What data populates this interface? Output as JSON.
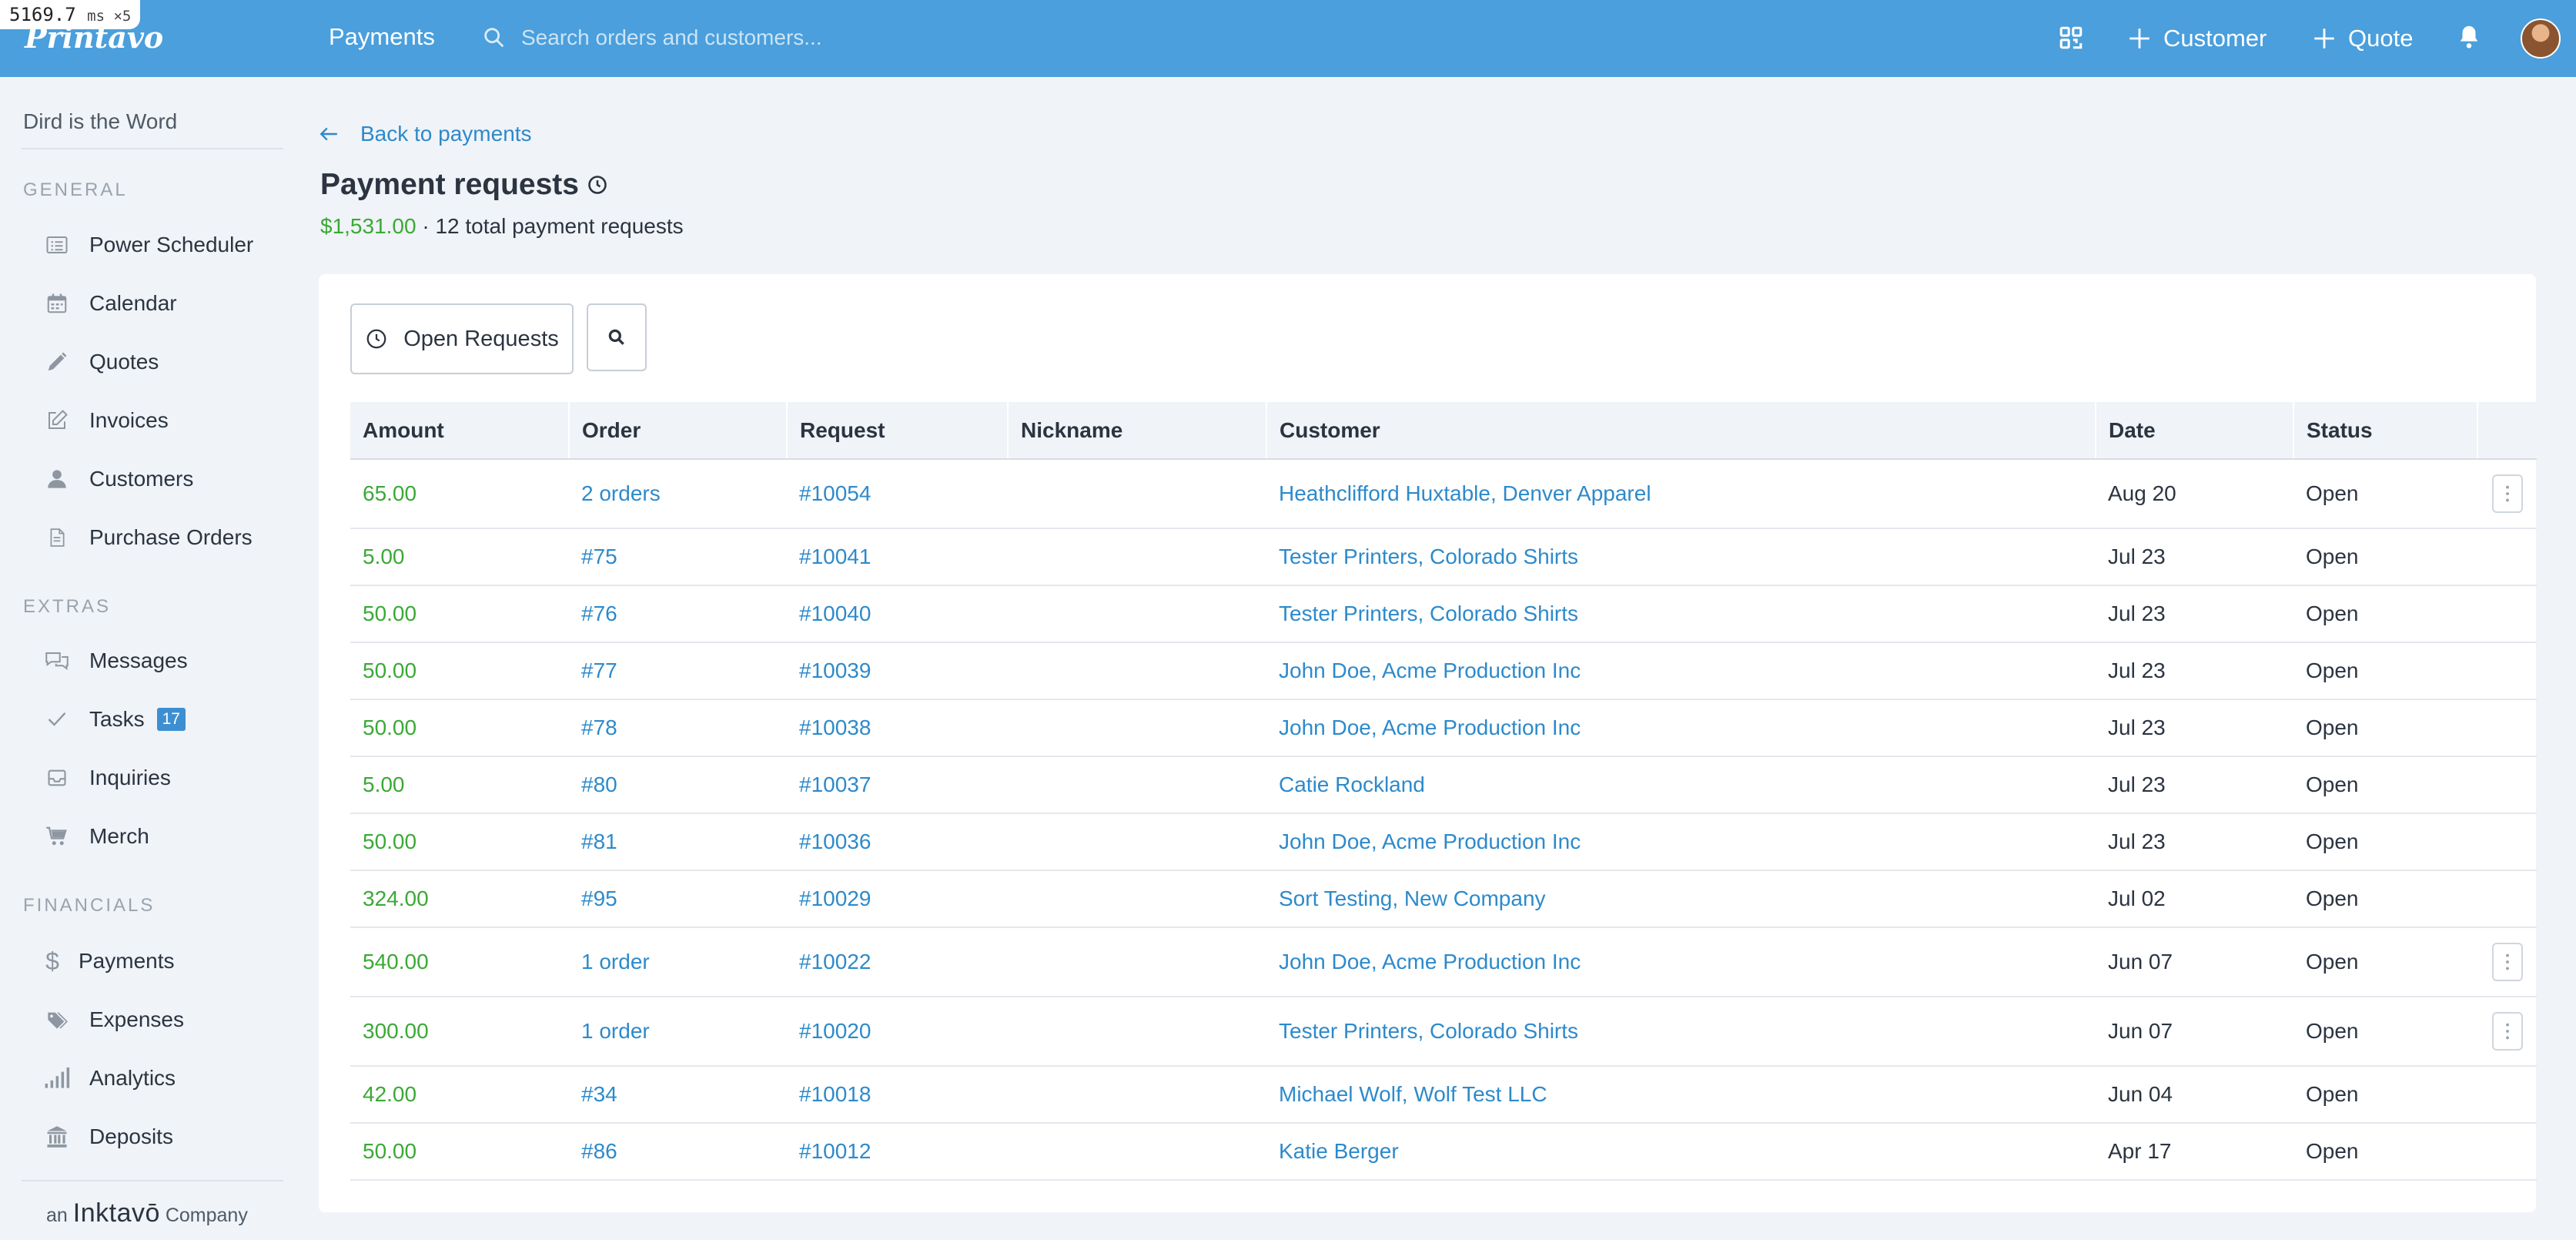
{
  "debug_overlay": {
    "value": "5169.7",
    "unit": "ms ×5"
  },
  "topbar": {
    "logo": "Printavo",
    "nav_payments": "Payments",
    "search_placeholder": "Search orders and customers...",
    "customer_label": "Customer",
    "quote_label": "Quote",
    "bg_color": "#4a9fdc"
  },
  "sidebar": {
    "company": "Dird is the Word",
    "general_title": "GENERAL",
    "general_items": [
      {
        "label": "Power Scheduler",
        "icon": "list-icon"
      },
      {
        "label": "Calendar",
        "icon": "calendar-icon"
      },
      {
        "label": "Quotes",
        "icon": "pencil-icon"
      },
      {
        "label": "Invoices",
        "icon": "edit-icon"
      },
      {
        "label": "Customers",
        "icon": "user-icon"
      },
      {
        "label": "Purchase Orders",
        "icon": "document-icon"
      }
    ],
    "extras_title": "EXTRAS",
    "extras_items": [
      {
        "label": "Messages",
        "icon": "chat-icon"
      },
      {
        "label": "Tasks",
        "icon": "check-icon",
        "badge": "17"
      },
      {
        "label": "Inquiries",
        "icon": "inbox-icon"
      },
      {
        "label": "Merch",
        "icon": "cart-icon"
      }
    ],
    "financials_title": "FINANCIALS",
    "financials_items": [
      {
        "label": "Payments",
        "icon": "dollar-icon"
      },
      {
        "label": "Expenses",
        "icon": "tag-icon"
      },
      {
        "label": "Analytics",
        "icon": "signal-bars-icon"
      },
      {
        "label": "Deposits",
        "icon": "bank-icon"
      }
    ],
    "brand_prefix": "an",
    "brand_name": "Inktavō",
    "brand_suffix": "Company"
  },
  "main": {
    "back_label": "Back to payments",
    "title": "Payment requests",
    "total_amount": "$1,531.00",
    "total_text": "· 12 total payment requests",
    "filter_label": "Open Requests"
  },
  "table": {
    "columns": [
      "Amount",
      "Order",
      "Request",
      "Nickname",
      "Customer",
      "Date",
      "Status",
      ""
    ],
    "rows": [
      {
        "amount": "65.00",
        "order": "2 orders",
        "request": "#10054",
        "nickname": "",
        "customer": "Heathclifford Huxtable, Denver Apparel",
        "date": "Aug 20",
        "status": "Open",
        "menu": true
      },
      {
        "amount": "5.00",
        "order": "#75",
        "request": "#10041",
        "nickname": "",
        "customer": "Tester Printers, Colorado Shirts",
        "date": "Jul 23",
        "status": "Open",
        "menu": false
      },
      {
        "amount": "50.00",
        "order": "#76",
        "request": "#10040",
        "nickname": "",
        "customer": "Tester Printers, Colorado Shirts",
        "date": "Jul 23",
        "status": "Open",
        "menu": false
      },
      {
        "amount": "50.00",
        "order": "#77",
        "request": "#10039",
        "nickname": "",
        "customer": "John Doe, Acme Production Inc",
        "date": "Jul 23",
        "status": "Open",
        "menu": false
      },
      {
        "amount": "50.00",
        "order": "#78",
        "request": "#10038",
        "nickname": "",
        "customer": "John Doe, Acme Production Inc",
        "date": "Jul 23",
        "status": "Open",
        "menu": false
      },
      {
        "amount": "5.00",
        "order": "#80",
        "request": "#10037",
        "nickname": "",
        "customer": "Catie Rockland",
        "date": "Jul 23",
        "status": "Open",
        "menu": false
      },
      {
        "amount": "50.00",
        "order": "#81",
        "request": "#10036",
        "nickname": "",
        "customer": "John Doe, Acme Production Inc",
        "date": "Jul 23",
        "status": "Open",
        "menu": false
      },
      {
        "amount": "324.00",
        "order": "#95",
        "request": "#10029",
        "nickname": "",
        "customer": "Sort Testing, New Company",
        "date": "Jul 02",
        "status": "Open",
        "menu": false
      },
      {
        "amount": "540.00",
        "order": "1 order",
        "request": "#10022",
        "nickname": "",
        "customer": "John Doe, Acme Production Inc",
        "date": "Jun 07",
        "status": "Open",
        "menu": true
      },
      {
        "amount": "300.00",
        "order": "1 order",
        "request": "#10020",
        "nickname": "",
        "customer": "Tester Printers, Colorado Shirts",
        "date": "Jun 07",
        "status": "Open",
        "menu": true
      },
      {
        "amount": "42.00",
        "order": "#34",
        "request": "#10018",
        "nickname": "",
        "customer": "Michael Wolf, Wolf Test LLC",
        "date": "Jun 04",
        "status": "Open",
        "menu": false
      },
      {
        "amount": "50.00",
        "order": "#86",
        "request": "#10012",
        "nickname": "",
        "customer": "Katie Berger",
        "date": "Apr 17",
        "status": "Open",
        "menu": false
      }
    ]
  },
  "colors": {
    "accent": "#2d8acb",
    "amount_green": "#3aa935",
    "badge_blue": "#3d8fd1"
  }
}
